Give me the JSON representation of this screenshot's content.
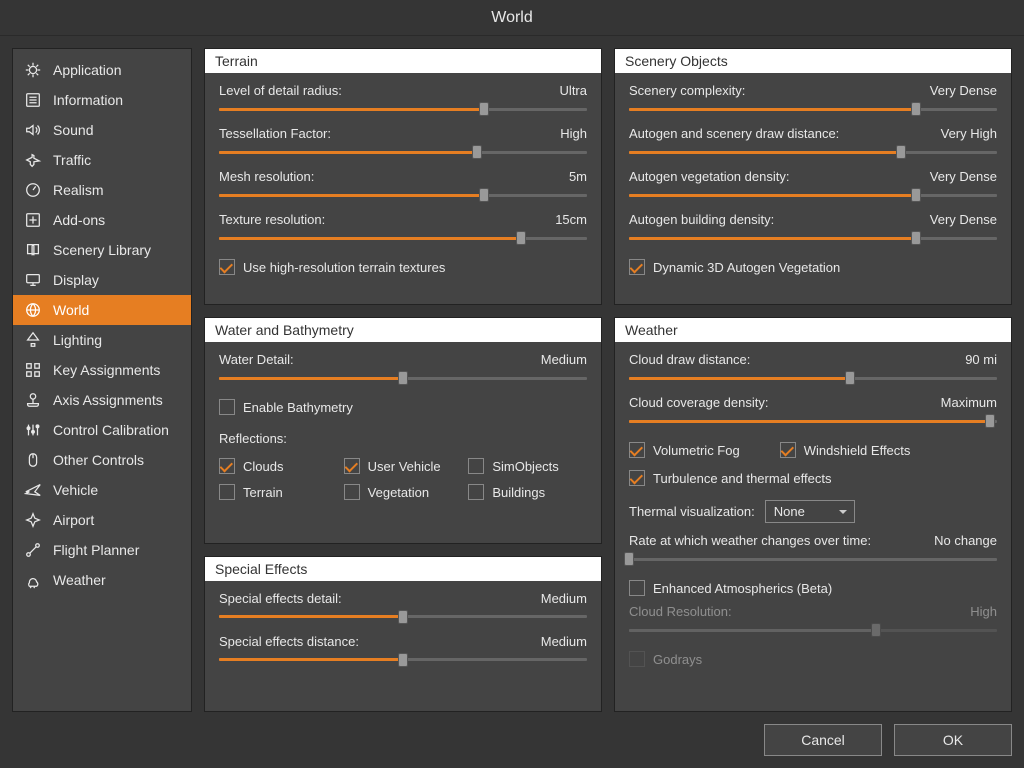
{
  "title": "World",
  "accent": "#E67E22",
  "sidebar": {
    "items": [
      {
        "id": "application",
        "label": "Application",
        "icon": "gear"
      },
      {
        "id": "information",
        "label": "Information",
        "icon": "list"
      },
      {
        "id": "sound",
        "label": "Sound",
        "icon": "speaker"
      },
      {
        "id": "traffic",
        "label": "Traffic",
        "icon": "planes"
      },
      {
        "id": "realism",
        "label": "Realism",
        "icon": "gauge"
      },
      {
        "id": "addons",
        "label": "Add-ons",
        "icon": "plus-box"
      },
      {
        "id": "scenery-lib",
        "label": "Scenery Library",
        "icon": "book"
      },
      {
        "id": "display",
        "label": "Display",
        "icon": "monitor"
      },
      {
        "id": "world",
        "label": "World",
        "icon": "globe",
        "active": true
      },
      {
        "id": "lighting",
        "label": "Lighting",
        "icon": "lamp"
      },
      {
        "id": "key-assign",
        "label": "Key Assignments",
        "icon": "grid"
      },
      {
        "id": "axis-assign",
        "label": "Axis Assignments",
        "icon": "joystick"
      },
      {
        "id": "control-cal",
        "label": "Control Calibration",
        "icon": "sliders"
      },
      {
        "id": "other-ctrl",
        "label": "Other Controls",
        "icon": "mouse"
      },
      {
        "id": "vehicle",
        "label": "Vehicle",
        "icon": "airplane"
      },
      {
        "id": "airport",
        "label": "Airport",
        "icon": "airplane-simple"
      },
      {
        "id": "flight-plan",
        "label": "Flight Planner",
        "icon": "route"
      },
      {
        "id": "weather",
        "label": "Weather",
        "icon": "weather"
      }
    ]
  },
  "panels": {
    "terrain": {
      "title": "Terrain",
      "sliders": [
        {
          "label": "Level of detail radius:",
          "value": "Ultra",
          "pct": 72
        },
        {
          "label": "Tessellation Factor:",
          "value": "High",
          "pct": 70
        },
        {
          "label": "Mesh resolution:",
          "value": "5m",
          "pct": 72
        },
        {
          "label": "Texture resolution:",
          "value": "15cm",
          "pct": 82
        }
      ],
      "check_hires": {
        "label": "Use high-resolution terrain textures",
        "checked": true
      }
    },
    "scenery": {
      "title": "Scenery Objects",
      "sliders": [
        {
          "label": "Scenery complexity:",
          "value": "Very Dense",
          "pct": 78
        },
        {
          "label": "Autogen and scenery draw distance:",
          "value": "Very High",
          "pct": 74
        },
        {
          "label": "Autogen vegetation density:",
          "value": "Very Dense",
          "pct": 78
        },
        {
          "label": "Autogen building density:",
          "value": "Very Dense",
          "pct": 78
        }
      ],
      "check_dyn": {
        "label": "Dynamic 3D Autogen Vegetation",
        "checked": true
      }
    },
    "water": {
      "title": "Water and Bathymetry",
      "slider_detail": {
        "label": "Water Detail:",
        "value": "Medium",
        "pct": 50
      },
      "check_bathy": {
        "label": "Enable Bathymetry",
        "checked": false
      },
      "reflections_label": "Reflections:",
      "reflections": [
        {
          "label": "Clouds",
          "checked": true
        },
        {
          "label": "User Vehicle",
          "checked": true
        },
        {
          "label": "SimObjects",
          "checked": false
        },
        {
          "label": "Terrain",
          "checked": false
        },
        {
          "label": "Vegetation",
          "checked": false
        },
        {
          "label": "Buildings",
          "checked": false
        }
      ]
    },
    "weather": {
      "title": "Weather",
      "slider_draw": {
        "label": "Cloud draw distance:",
        "value": "90 mi",
        "pct": 60
      },
      "slider_coverage": {
        "label": "Cloud coverage density:",
        "value": "Maximum",
        "pct": 98
      },
      "check_volfog": {
        "label": "Volumetric Fog",
        "checked": true
      },
      "check_windshield": {
        "label": "Windshield Effects",
        "checked": true
      },
      "check_turb": {
        "label": "Turbulence and thermal effects",
        "checked": true
      },
      "thermal_viz": {
        "label": "Thermal visualization:",
        "value": "None"
      },
      "slider_rate": {
        "label": "Rate at which weather changes over time:",
        "value": "No change",
        "pct": 0
      },
      "check_atmos": {
        "label": "Enhanced Atmospherics (Beta)",
        "checked": false
      },
      "slider_cloudres": {
        "label": "Cloud Resolution:",
        "value": "High",
        "pct": 67,
        "disabled": true
      },
      "check_godrays": {
        "label": "Godrays",
        "checked": false,
        "disabled": true
      }
    },
    "sfx": {
      "title": "Special Effects",
      "sliders": [
        {
          "label": "Special effects detail:",
          "value": "Medium",
          "pct": 50
        },
        {
          "label": "Special effects distance:",
          "value": "Medium",
          "pct": 50
        }
      ]
    }
  },
  "footer": {
    "cancel": "Cancel",
    "ok": "OK"
  }
}
